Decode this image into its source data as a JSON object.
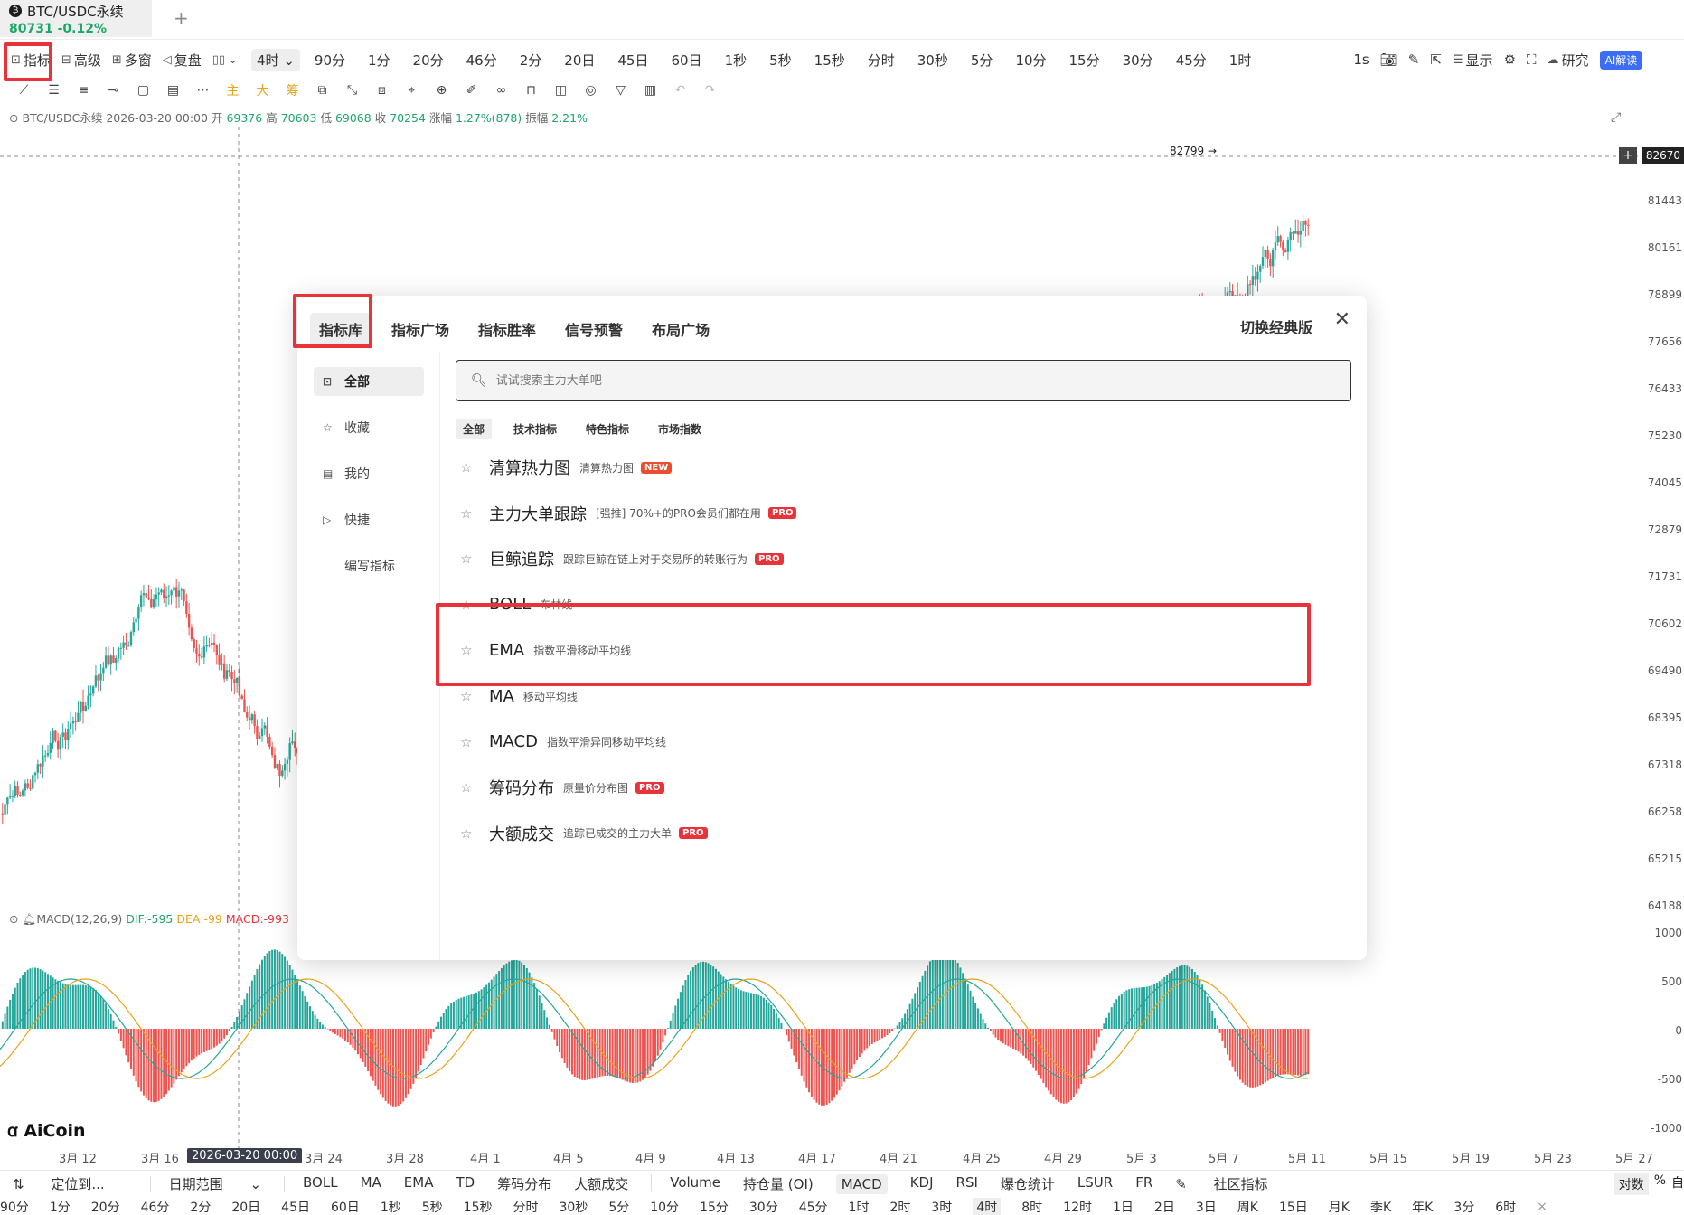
{
  "tab": {
    "symbol": "BTC/USDC永续",
    "price": "80731",
    "change": "-0.12%",
    "add": "+"
  },
  "toolbar": {
    "indicator": "指标",
    "advanced": "高级",
    "multi_window": "多窗",
    "replay": "复盘",
    "interval_selected": "4时",
    "intervals": [
      "90分",
      "1分",
      "20分",
      "46分",
      "2分",
      "20日",
      "45日",
      "60日",
      "1秒",
      "5秒",
      "15秒",
      "分时",
      "30秒",
      "5分",
      "10分",
      "15分",
      "30分",
      "45分",
      "1时"
    ],
    "right_interval": "1s",
    "display": "显示",
    "research": "研究",
    "ai": "AI解读"
  },
  "drawing_tools": [
    "主",
    "大",
    "筹"
  ],
  "ohlc": {
    "symbol": "BTC/USDC永续",
    "datetime": "2026-03-20 00:00",
    "open_label": "开",
    "open": "69376",
    "high_label": "高",
    "high": "70603",
    "low_label": "低",
    "low": "69068",
    "close_label": "收",
    "close": "70254",
    "change_label": "涨幅",
    "change": "1.27%(878)",
    "amp_label": "振幅",
    "amp": "2.21%"
  },
  "macd": {
    "title": "MACD(12,26,9)",
    "dif": "DIF:-595",
    "dea": "DEA:-99",
    "macd": "MACD:-993"
  },
  "chart": {
    "high_marker": "82799 →",
    "price_tag": "82670",
    "y_labels": [
      "81443",
      "80161",
      "78899",
      "77656",
      "76433",
      "75230",
      "74045",
      "72879",
      "71731",
      "70602",
      "69490",
      "68395",
      "67318",
      "66258",
      "65215",
      "64188"
    ],
    "macd_y_labels": [
      "1000",
      "500",
      "0",
      "-500",
      "-1000"
    ],
    "x_labels": [
      "3月 12",
      "3月 16",
      "3月 24",
      "3月 28",
      "4月 1",
      "4月 5",
      "4月 9",
      "4月 13",
      "4月 17",
      "4月 21",
      "4月 25",
      "4月 29",
      "5月 3",
      "5月 7",
      "5月 11",
      "5月 15",
      "5月 19",
      "5月 23",
      "5月 27"
    ],
    "x_selected": "2026-03-20 00:00",
    "logo": "AiCoin"
  },
  "modal": {
    "tabs": [
      "指标库",
      "指标广场",
      "指标胜率",
      "信号预警",
      "布局广场"
    ],
    "classic": "切换经典版",
    "close": "✕",
    "side": [
      "全部",
      "收藏",
      "我的",
      "快捷",
      "编写指标"
    ],
    "search_placeholder": "试试搜索主力大单吧",
    "filters": [
      "全部",
      "技术指标",
      "特色指标",
      "市场指数"
    ],
    "indicators": [
      {
        "name": "清算热力图",
        "desc": "清算热力图",
        "badge": "NEW"
      },
      {
        "name": "主力大单跟踪",
        "desc": "[强推] 70%+的PRO会员们都在用",
        "badge": "PRO"
      },
      {
        "name": "巨鲸追踪",
        "desc": "跟踪巨鲸在链上对于交易所的转账行为",
        "badge": "PRO"
      },
      {
        "name": "BOLL",
        "desc": "布林线",
        "badge": ""
      },
      {
        "name": "EMA",
        "desc": "指数平滑移动平均线",
        "badge": ""
      },
      {
        "name": "MA",
        "desc": "移动平均线",
        "badge": ""
      },
      {
        "name": "MACD",
        "desc": "指数平滑异同移动平均线",
        "badge": ""
      },
      {
        "name": "筹码分布",
        "desc": "原量价分布图",
        "badge": "PRO"
      },
      {
        "name": "大额成交",
        "desc": "追踪已成交的主力大单",
        "badge": "PRO"
      }
    ]
  },
  "bottom": {
    "locate": "定位到...",
    "date_range": "日期范围",
    "indicators": [
      "BOLL",
      "MA",
      "EMA",
      "TD",
      "筹码分布",
      "大额成交",
      "Volume",
      "持仓量 (OI)",
      "MACD",
      "KDJ",
      "RSI",
      "爆仓统计",
      "LSUR",
      "FR",
      "社区指标"
    ],
    "active_indicator": "MACD",
    "right": [
      "对数",
      "%",
      "自"
    ],
    "intervals": [
      "90分",
      "1分",
      "20分",
      "46分",
      "2分",
      "20日",
      "45日",
      "60日",
      "1秒",
      "5秒",
      "15秒",
      "分时",
      "30秒",
      "5分",
      "10分",
      "15分",
      "30分",
      "45分",
      "1时",
      "2时",
      "3时",
      "4时",
      "8时",
      "12时",
      "1日",
      "2日",
      "3日",
      "周K",
      "15日",
      "月K",
      "季K",
      "年K",
      "3分",
      "6时"
    ],
    "active_interval": "4时"
  }
}
